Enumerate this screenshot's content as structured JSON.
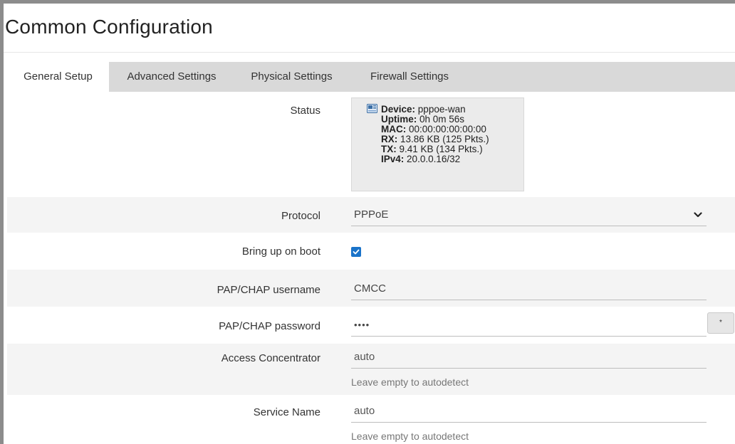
{
  "page": {
    "title": "Common Configuration"
  },
  "tabs": [
    {
      "label": "General Setup",
      "active": true
    },
    {
      "label": "Advanced Settings",
      "active": false
    },
    {
      "label": "Physical Settings",
      "active": false
    },
    {
      "label": "Firewall Settings",
      "active": false
    }
  ],
  "status": {
    "label": "Status",
    "icon": "network-device-icon",
    "device_key": "Device:",
    "device_val": "pppoe-wan",
    "uptime_key": "Uptime:",
    "uptime_val": "0h 0m 56s",
    "mac_key": "MAC:",
    "mac_val": "00:00:00:00:00:00",
    "rx_key": "RX:",
    "rx_val": "13.86 KB (125 Pkts.)",
    "tx_key": "TX:",
    "tx_val": "9.41 KB (134 Pkts.)",
    "ipv4_key": "IPv4:",
    "ipv4_val": "20.0.0.16/32"
  },
  "protocol": {
    "label": "Protocol",
    "value": "PPPoE"
  },
  "boot": {
    "label": "Bring up on boot",
    "checked": true
  },
  "username": {
    "label": "PAP/CHAP username",
    "value": "CMCC"
  },
  "password": {
    "label": "PAP/CHAP password",
    "value": "••••",
    "reveal_label": "*"
  },
  "access_concentrator": {
    "label": "Access Concentrator",
    "placeholder": "auto",
    "hint": "Leave empty to autodetect"
  },
  "service_name": {
    "label": "Service Name",
    "placeholder": "auto",
    "hint": "Leave empty to autodetect"
  },
  "colors": {
    "tab_bar": "#d9d9d9",
    "checkbox": "#1a73c9",
    "row_shade": "#f4f4f4"
  }
}
